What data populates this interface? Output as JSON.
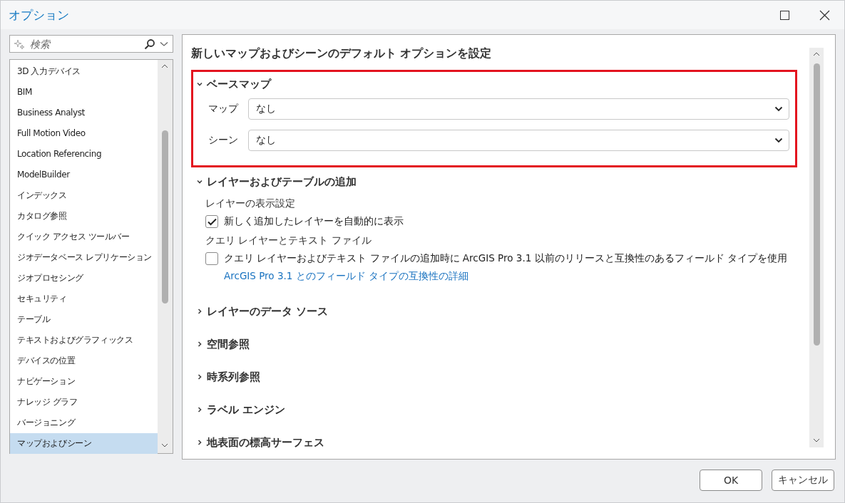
{
  "window": {
    "title": "オプション"
  },
  "search": {
    "placeholder": "検索"
  },
  "sidebar": {
    "items": [
      {
        "label": "3D 入力デバイス",
        "selected": false
      },
      {
        "label": "BIM",
        "selected": false
      },
      {
        "label": "Business Analyst",
        "selected": false
      },
      {
        "label": "Full Motion Video",
        "selected": false
      },
      {
        "label": "Location Referencing",
        "selected": false
      },
      {
        "label": "ModelBuilder",
        "selected": false
      },
      {
        "label": "インデックス",
        "selected": false
      },
      {
        "label": "カタログ参照",
        "selected": false
      },
      {
        "label": "クイック アクセス ツールバー",
        "selected": false
      },
      {
        "label": "ジオデータベース レプリケーション",
        "selected": false
      },
      {
        "label": "ジオプロセシング",
        "selected": false
      },
      {
        "label": "セキュリティ",
        "selected": false
      },
      {
        "label": "テーブル",
        "selected": false
      },
      {
        "label": "テキストおよびグラフィックス",
        "selected": false
      },
      {
        "label": "デバイスの位置",
        "selected": false
      },
      {
        "label": "ナビゲーション",
        "selected": false
      },
      {
        "label": "ナレッジ グラフ",
        "selected": false
      },
      {
        "label": "バージョニング",
        "selected": false
      },
      {
        "label": "マップおよびシーン",
        "selected": true
      }
    ]
  },
  "content": {
    "heading": "新しいマップおよびシーンのデフォルト オプションを設定",
    "sections": [
      {
        "title": "ベースマップ",
        "expanded": true,
        "highlighted": true,
        "fields": [
          {
            "label": "マップ",
            "value": "なし"
          },
          {
            "label": "シーン",
            "value": "なし"
          }
        ]
      },
      {
        "title": "レイヤーおよびテーブルの追加",
        "expanded": true,
        "highlighted": false,
        "groups": [
          {
            "label": "レイヤーの表示設定",
            "options": [
              {
                "label": "新しく追加したレイヤーを自動的に表示",
                "checked": true
              }
            ]
          },
          {
            "label": "クエリ レイヤーとテキスト ファイル",
            "options": [
              {
                "label": "クエリ レイヤーおよびテキスト ファイルの追加時に ArcGIS Pro 3.1 以前のリリースと互換性のあるフィールド タイプを使用",
                "checked": false,
                "link": "ArcGIS Pro 3.1 とのフィールド タイプの互換性の詳細"
              }
            ]
          }
        ]
      },
      {
        "title": "レイヤーのデータ ソース",
        "expanded": false,
        "highlighted": false
      },
      {
        "title": "空間参照",
        "expanded": false,
        "highlighted": false
      },
      {
        "title": "時系列参照",
        "expanded": false,
        "highlighted": false
      },
      {
        "title": "ラベル エンジン",
        "expanded": false,
        "highlighted": false
      },
      {
        "title": "地表面の標高サーフェス",
        "expanded": false,
        "highlighted": false
      }
    ]
  },
  "buttons": [
    "OK",
    "キャンセル"
  ]
}
